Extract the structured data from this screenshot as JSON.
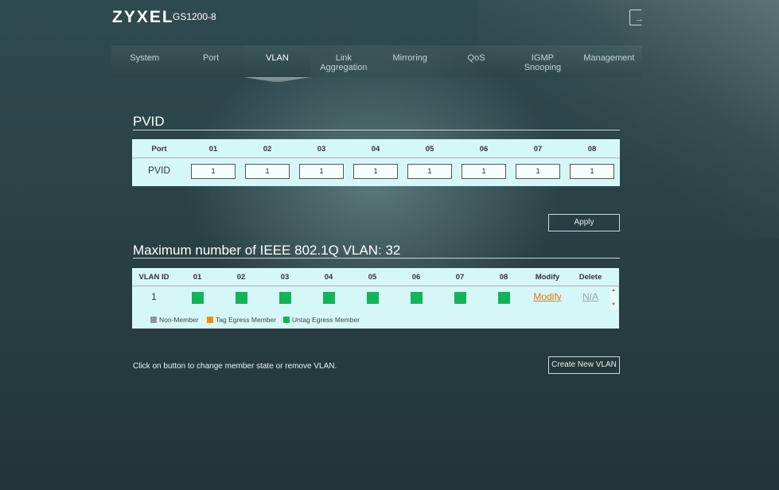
{
  "header": {
    "brand": "ZYXEL",
    "model": "GS1200-8",
    "logout_icon": "logout-icon"
  },
  "nav": [
    {
      "label": "System"
    },
    {
      "label": "Port"
    },
    {
      "label": "VLAN"
    },
    {
      "label": "Link Aggregation"
    },
    {
      "label": "Mirroring"
    },
    {
      "label": "QoS"
    },
    {
      "label": "IGMP Snooping"
    },
    {
      "label": "Management"
    }
  ],
  "pvid": {
    "title": "PVID",
    "port_header": "Port",
    "row_label": "PVID",
    "ports": [
      "01",
      "02",
      "03",
      "04",
      "05",
      "06",
      "07",
      "08"
    ],
    "values": [
      "1",
      "1",
      "1",
      "1",
      "1",
      "1",
      "1",
      "1"
    ],
    "apply_label": "Apply"
  },
  "vlan": {
    "title": "Maximum number of IEEE 802.1Q VLAN: 32",
    "headers": [
      "VLAN ID",
      "01",
      "02",
      "03",
      "04",
      "05",
      "06",
      "07",
      "08",
      "Modify",
      "Delete"
    ],
    "rows": [
      {
        "id": "1",
        "members": [
          "untag",
          "untag",
          "untag",
          "untag",
          "untag",
          "untag",
          "untag",
          "untag"
        ],
        "modify": "Modify",
        "delete": "N/A"
      }
    ],
    "legend": [
      "Non-Member",
      "Tag Egress Member",
      "Untag Egress Member"
    ],
    "colors": {
      "non_member": "#8c9696",
      "tag": "#f08c00",
      "untag": "#13b35a",
      "link": "#e8721b"
    }
  },
  "footer": {
    "hint": "Click on button to change member state or remove VLAN.",
    "create_label": "Create New VLAN"
  }
}
